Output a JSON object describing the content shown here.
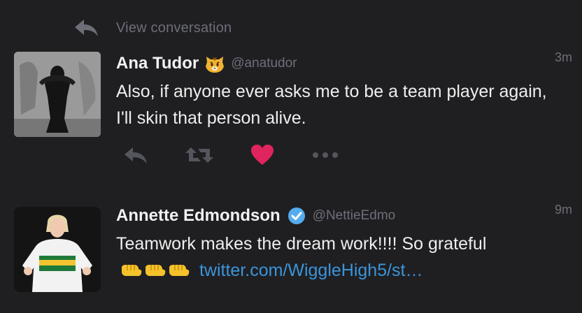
{
  "context": {
    "label": "View conversation",
    "icon": "reply-arrow-icon"
  },
  "tweets": [
    {
      "name": "Ana Tudor",
      "badge": "tiger-emoji",
      "handle": "@anatudor",
      "time": "3m",
      "text": "Also, if anyone ever asks me to be a team player again, I'll skin that person alive.",
      "actions": [
        "reply-icon",
        "retweet-icon",
        "heart-icon",
        "more-icon"
      ],
      "liked": true,
      "heart_color": "#e0245e"
    },
    {
      "name": "Annette Edmondson",
      "badge": "verified-badge",
      "handle": "@NettieEdmo",
      "time": "9m",
      "text_before": "Teamwork makes the dream work!!!! So grateful",
      "emoji": [
        "fist-bump-emoji",
        "fist-bump-emoji",
        "fist-bump-emoji"
      ],
      "link": "twitter.com/WiggleHigh5/st…",
      "link_color": "#3b94d9"
    }
  ],
  "colors": {
    "background": "#1f1f22",
    "muted": "#6d6e78",
    "verified": "#55acee"
  }
}
